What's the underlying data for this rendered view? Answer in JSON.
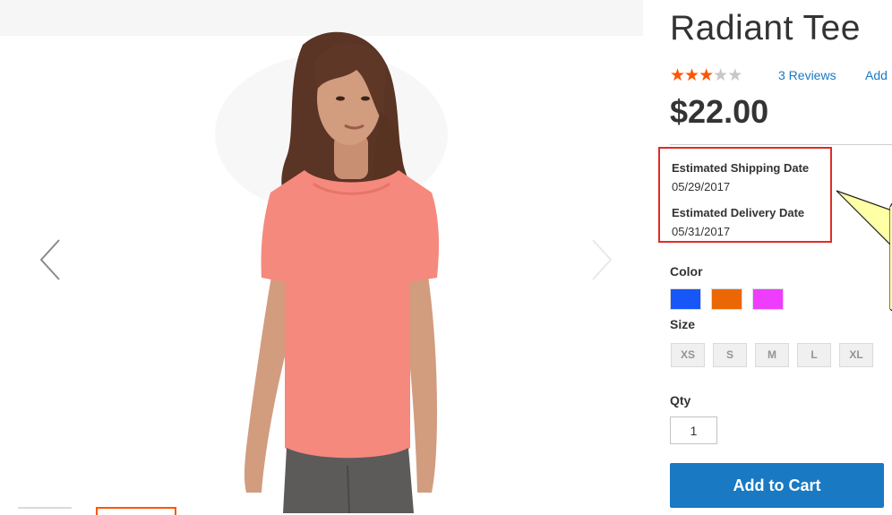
{
  "product": {
    "title": "Radiant Tee",
    "rating": {
      "stars_filled": 3,
      "stars_total": 5
    },
    "reviews_link": "3 Reviews",
    "add_review_link": "Add",
    "price": "$22.00"
  },
  "shipping": {
    "shipping_label": "Estimated Shipping Date",
    "shipping_date": "05/29/2017",
    "delivery_label": "Estimated Delivery Date",
    "delivery_date": "05/31/2017",
    "highlight_color": "#e02b27"
  },
  "options": {
    "color_label": "Color",
    "colors": [
      {
        "name": "Blue",
        "hex": "#1857f7"
      },
      {
        "name": "Orange",
        "hex": "#eb6703"
      },
      {
        "name": "Purple",
        "hex": "#ef3dff"
      }
    ],
    "size_label": "Size",
    "sizes": [
      "XS",
      "S",
      "M",
      "L",
      "XL"
    ]
  },
  "qty": {
    "label": "Qty",
    "value": "1"
  },
  "cart": {
    "button_label": "Add to Cart",
    "accent": "#1979c3"
  },
  "gallery": {
    "prev_icon": "chevron-left-icon",
    "next_icon": "chevron-right-icon",
    "shirt_color": "#f5897e",
    "active_thumb_color": "#ff5501"
  }
}
